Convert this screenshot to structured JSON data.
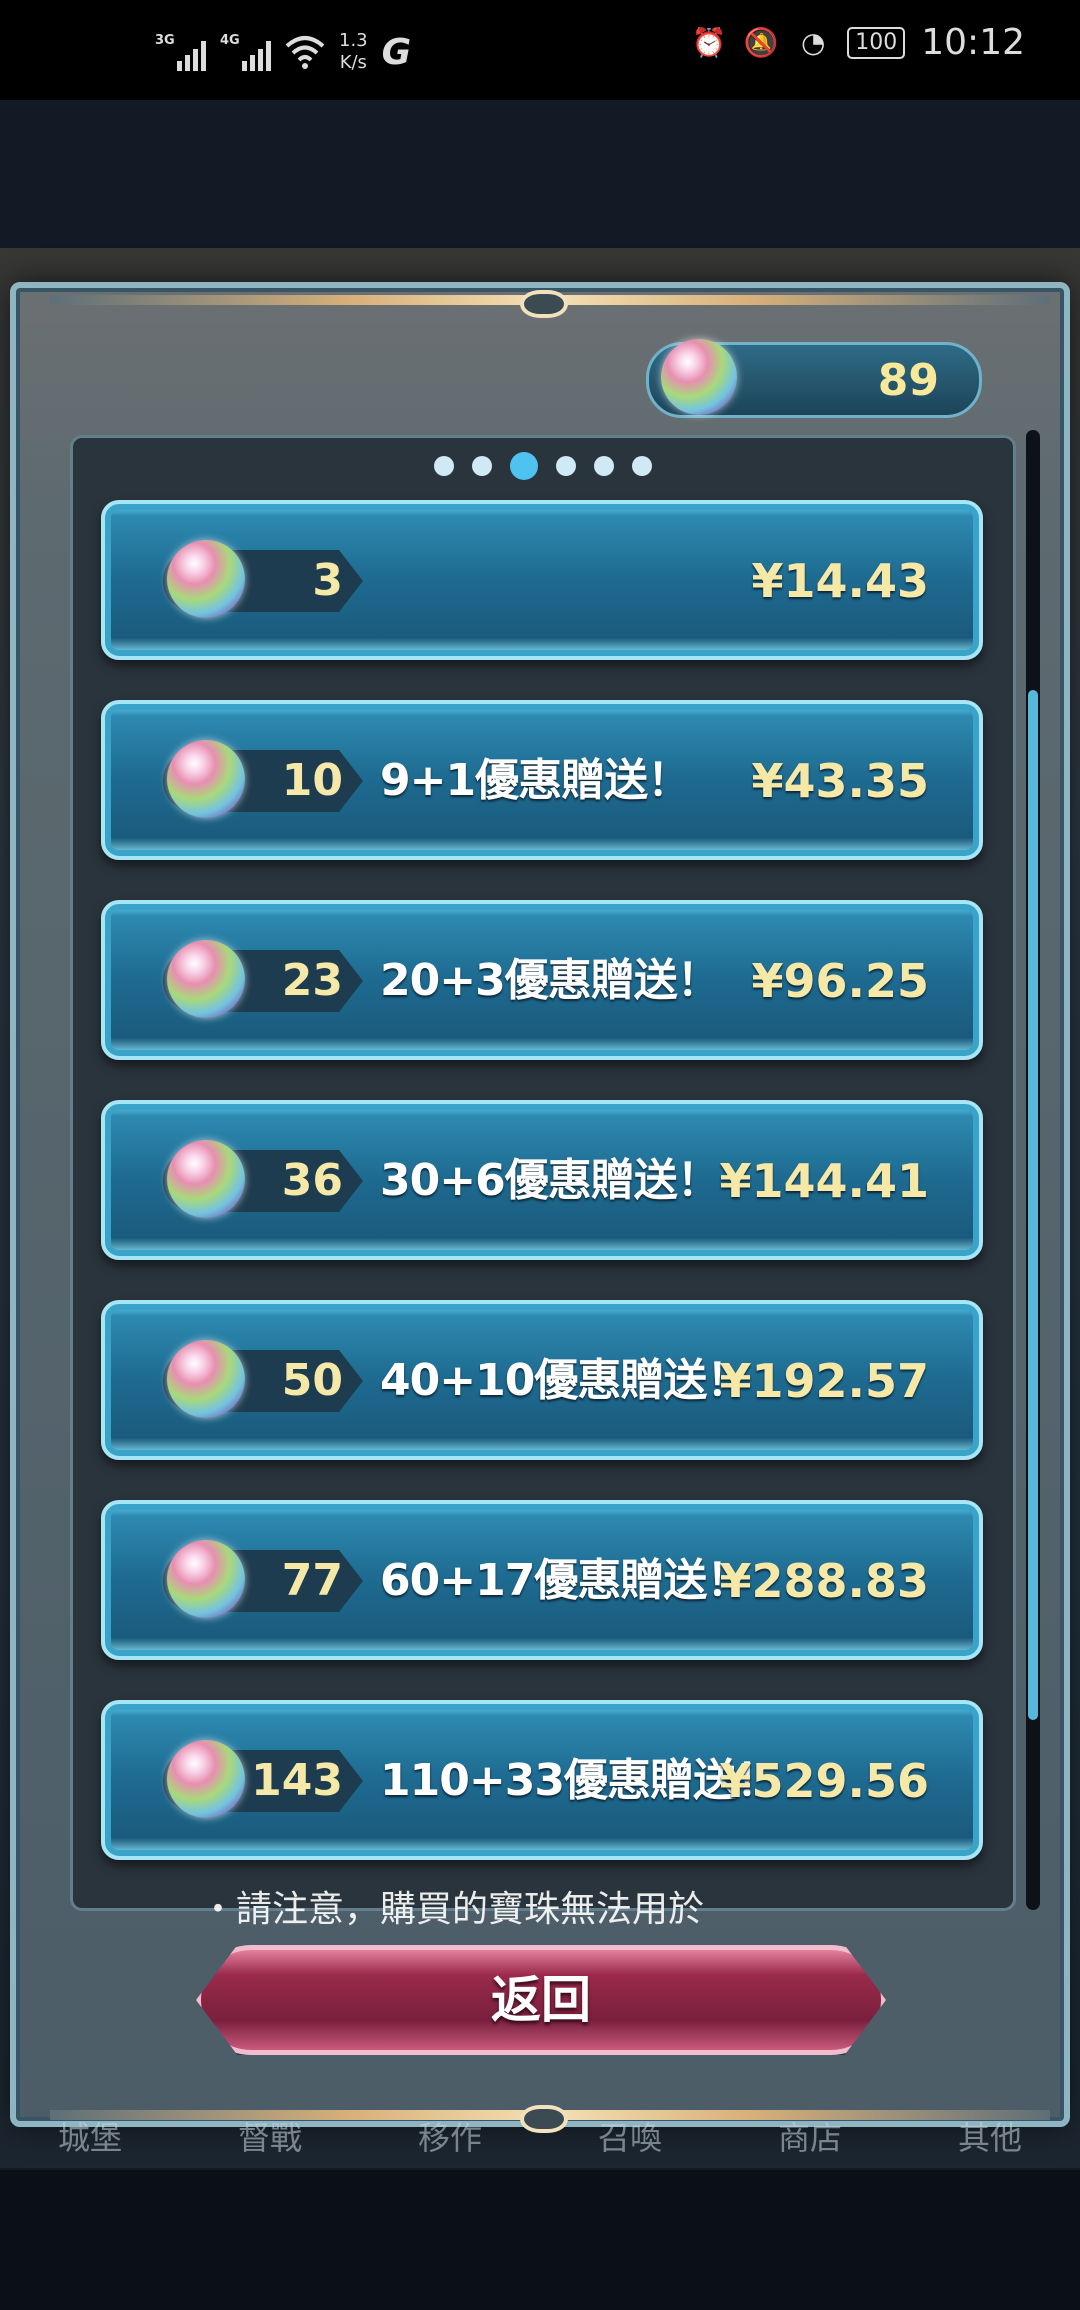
{
  "status_bar": {
    "signal1_label": "3G",
    "signal2_label": "4G",
    "net_speed_value": "1.3",
    "net_speed_unit": "K/s",
    "battery": "100",
    "time": "10:12"
  },
  "orb_counter": {
    "value": "89"
  },
  "pager": {
    "pages": 6,
    "active_index": 2
  },
  "packages": [
    {
      "qty": "3",
      "bonus": "",
      "price": "¥14.43"
    },
    {
      "qty": "10",
      "bonus": "9+1優惠贈送！",
      "price": "¥43.35"
    },
    {
      "qty": "23",
      "bonus": "20+3優惠贈送！",
      "price": "¥96.25"
    },
    {
      "qty": "36",
      "bonus": "30+6優惠贈送！",
      "price": "¥144.41"
    },
    {
      "qty": "50",
      "bonus": "40+10優惠贈送！",
      "price": "¥192.57"
    },
    {
      "qty": "77",
      "bonus": "60+17優惠贈送！",
      "price": "¥288.83"
    },
    {
      "qty": "143",
      "bonus": "110+33優惠贈送！",
      "price": "¥529.56"
    }
  ],
  "notice": "・請注意，購買的寶珠無法用於",
  "back_button": "返回",
  "bottom_nav": [
    "城堡",
    "督戰",
    "移作",
    "召喚",
    "商店",
    "其他"
  ],
  "colors": {
    "accent": "#4fc3f0",
    "gold_text": "#f6e9a8",
    "button_pink": "#9a2a4b"
  }
}
